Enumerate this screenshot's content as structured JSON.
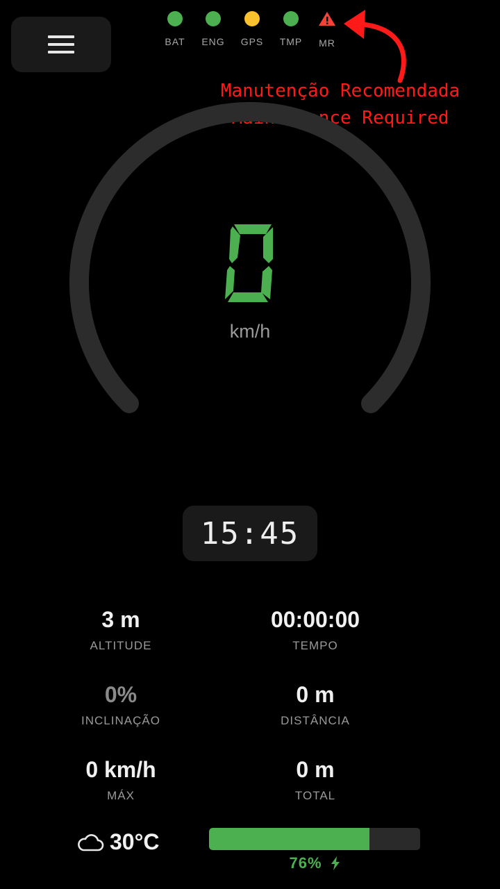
{
  "header": {
    "menu_icon": "hamburger-icon",
    "status_indicators": [
      {
        "label": "BAT",
        "color": "#4caf50"
      },
      {
        "label": "ENG",
        "color": "#4caf50"
      },
      {
        "label": "GPS",
        "color": "#fbc02d"
      },
      {
        "label": "TMP",
        "color": "#4caf50"
      },
      {
        "label": "MR",
        "color": "#f44336",
        "icon": "warning-triangle-icon"
      }
    ]
  },
  "annotation": {
    "line1": "Manutenção Recomendada",
    "line2": "Maintenance Required",
    "color": "#ff1a1a"
  },
  "speedometer": {
    "speed": "0",
    "unit": "km/h",
    "digit_color": "#4caf50",
    "track_color": "#2c2c2c"
  },
  "clock": {
    "time": "15:45"
  },
  "stats": {
    "altitude": {
      "value": "3 m",
      "label": "ALTITUDE"
    },
    "tempo": {
      "value": "00:00:00",
      "label": "TEMPO"
    },
    "inclinacao": {
      "value": "0%",
      "label": "INCLINAÇÃO"
    },
    "distancia": {
      "value": "0 m",
      "label": "DISTÂNCIA"
    },
    "max": {
      "value": "0 km/h",
      "label": "MÁX"
    },
    "total": {
      "value": "0 m",
      "label": "TOTAL"
    }
  },
  "weather": {
    "icon": "cloud-icon",
    "temperature": "30°C"
  },
  "battery": {
    "level": 76,
    "percent_text": "76%",
    "charging_icon": "lightning-bolt-icon",
    "color": "#4caf50"
  }
}
